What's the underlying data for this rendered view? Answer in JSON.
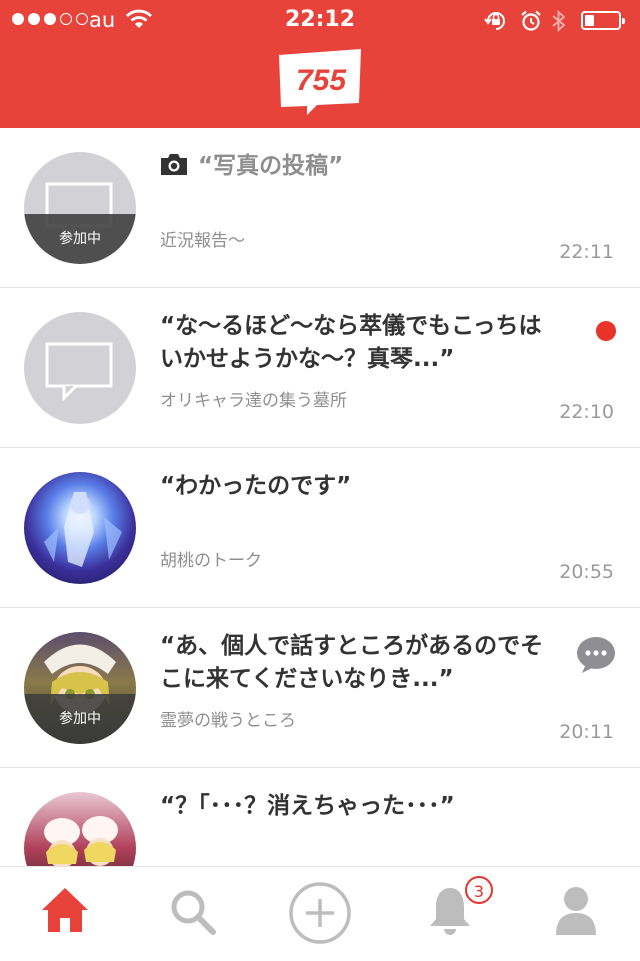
{
  "status_bar": {
    "carrier": "au",
    "time": "22:12",
    "signal_bars_filled": 3,
    "signal_bars_total": 5,
    "battery_level": 0.25,
    "icons": [
      "wifi-icon",
      "orientation-lock-icon",
      "alarm-icon",
      "bluetooth-icon",
      "battery-icon"
    ]
  },
  "header": {
    "logo_text": "755",
    "bg_color": "#e8433b"
  },
  "talks": [
    {
      "message": "“写真の投稿”",
      "room": "近況報告〜",
      "time": "22:11",
      "joined_label": "参加中",
      "avatar": "placeholder",
      "icon": "camera-icon"
    },
    {
      "message": "“な〜るほど〜なら萃儀でもこっちはいかせようかな〜？真琴...”",
      "room": "オリキャラ達の集う墓所",
      "time": "22:10",
      "avatar": "placeholder",
      "indicator": "unread-dot"
    },
    {
      "message": "“わかったのです”",
      "room": "胡桃のトーク",
      "time": "20:55",
      "avatar": "image"
    },
    {
      "message": "“あ、個人で話すところがあるのでそこに来てくださいなりき...”",
      "room": "霊夢の戦うところ",
      "time": "20:11",
      "joined_label": "参加中",
      "avatar": "image",
      "indicator": "comment-bubble-icon"
    },
    {
      "message": "“？｢･･･？消えちゃった･･･”",
      "avatar": "image"
    }
  ],
  "tab_bar": {
    "active_color": "#e8433b",
    "inactive_color": "#bdbdbd",
    "tabs": [
      "home-icon",
      "search-icon",
      "add-icon",
      "bell-icon",
      "profile-icon"
    ],
    "notification_count": "3"
  }
}
